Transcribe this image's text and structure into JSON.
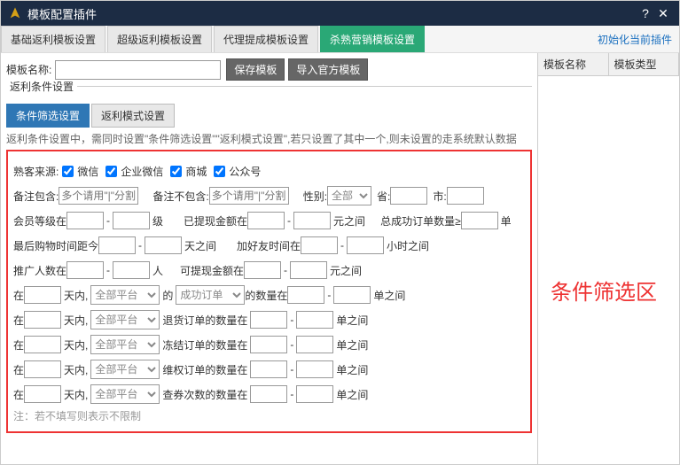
{
  "window": {
    "title": "模板配置插件"
  },
  "tabs": {
    "items": [
      "基础返利模板设置",
      "超级返利模板设置",
      "代理提成模板设置",
      "杀熟营销模板设置"
    ],
    "activeIndex": 3,
    "initLink": "初始化当前插件"
  },
  "nameRow": {
    "label": "模板名称:",
    "value": "",
    "saveBtn": "保存模板",
    "importBtn": "导入官方模板"
  },
  "fieldsetLabel": "返利条件设置",
  "subtabs": {
    "items": [
      "条件筛选设置",
      "返利模式设置"
    ],
    "activeIndex": 0
  },
  "hint": "返利条件设置中，需同时设置\"条件筛选设置\"\"返利模式设置\",若只设置了其中一个,则未设置的走系统默认数据",
  "sources": {
    "label": "熟客来源:",
    "opt1": "微信",
    "opt2": "企业微信",
    "opt3": "商城",
    "opt4": "公众号"
  },
  "row2": {
    "incLabel": "备注包含:",
    "incPh": "多个请用\"|\"分割",
    "excLabel": "备注不包含:",
    "excPh": "多个请用\"|\"分割",
    "genderLabel": "性别:",
    "genderOpt": "全部",
    "provLabel": "省:",
    "cityLabel": "市:"
  },
  "row3": {
    "lvlLabel": "会员等级在",
    "dash": "-",
    "lvlUnit": "级",
    "cashLabel": "已提现金额在",
    "cashUnit": "元之间",
    "orderLabel": "总成功订单数量≥",
    "orderUnit": "单"
  },
  "row4": {
    "shopLabel": "最后购物时间距今",
    "shopUnit": "天之间",
    "friendLabel": "加好友时间在",
    "friendUnit": "小时之间"
  },
  "row5": {
    "promLabel": "推广人数在",
    "promUnit": "人",
    "wcashLabel": "可提现金额在",
    "wcashUnit": "元之间"
  },
  "row6": {
    "inLabel": "在",
    "dayUnit": "天内,",
    "platOpt": "全部平台",
    "of": "的",
    "orderOpt": "成功订单",
    "qtyLabel": "的数量在",
    "qtyUnit": "单之间"
  },
  "row7": {
    "txt": "退货订单的数量在",
    "unit": "单之间"
  },
  "row8": {
    "txt": "冻结订单的数量在",
    "unit": "单之间"
  },
  "row9": {
    "txt": "维权订单的数量在",
    "unit": "单之间"
  },
  "row10": {
    "txt": "查券次数的数量在",
    "unit": "单之间"
  },
  "note": "注：若不填写则表示不限制",
  "side": {
    "col1": "模板名称",
    "col2": "模板类型"
  },
  "annotation": "条件筛选区"
}
